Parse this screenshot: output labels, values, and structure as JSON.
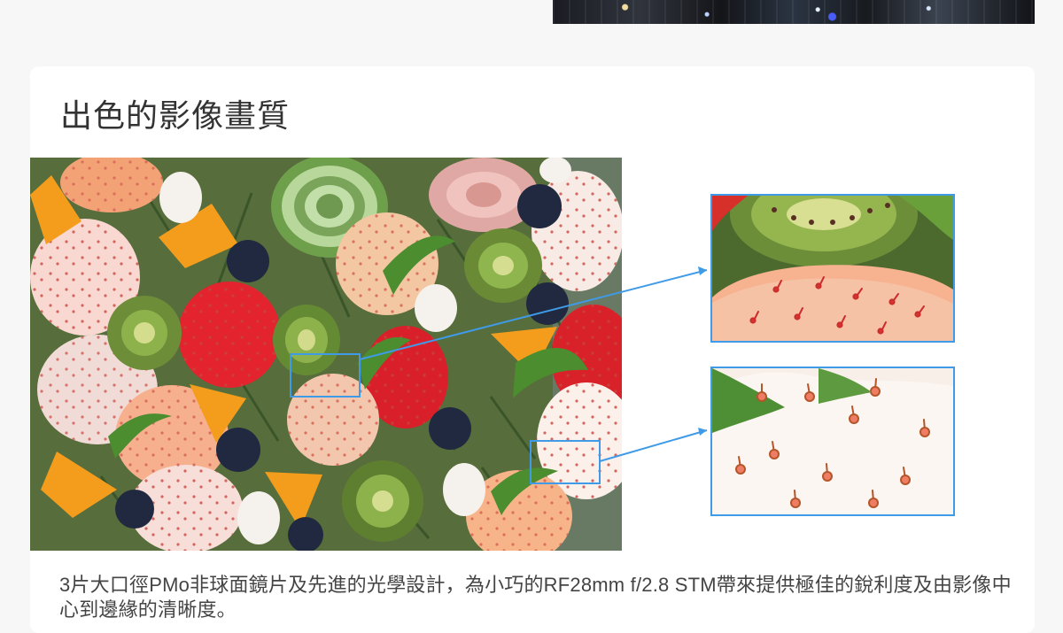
{
  "section": {
    "title": "出色的影像畫質",
    "description": "3片大口徑PMo非球面鏡片及先進的光學設計，為小巧的RF28mm f/2.8 STM帶來提供極佳的銳利度及由影像中心到邊緣的清晰度。"
  },
  "colors": {
    "page_background": "#f7f7f7",
    "card_background": "#ffffff",
    "highlight_blue": "#3f9ae8",
    "title_text": "#333333"
  },
  "images": {
    "top_strip": "city-night-photo",
    "main_photo": "fruit-salad-photo",
    "zoom_top": "strawberry-kiwi-closeup",
    "zoom_bottom": "white-strawberry-closeup"
  }
}
